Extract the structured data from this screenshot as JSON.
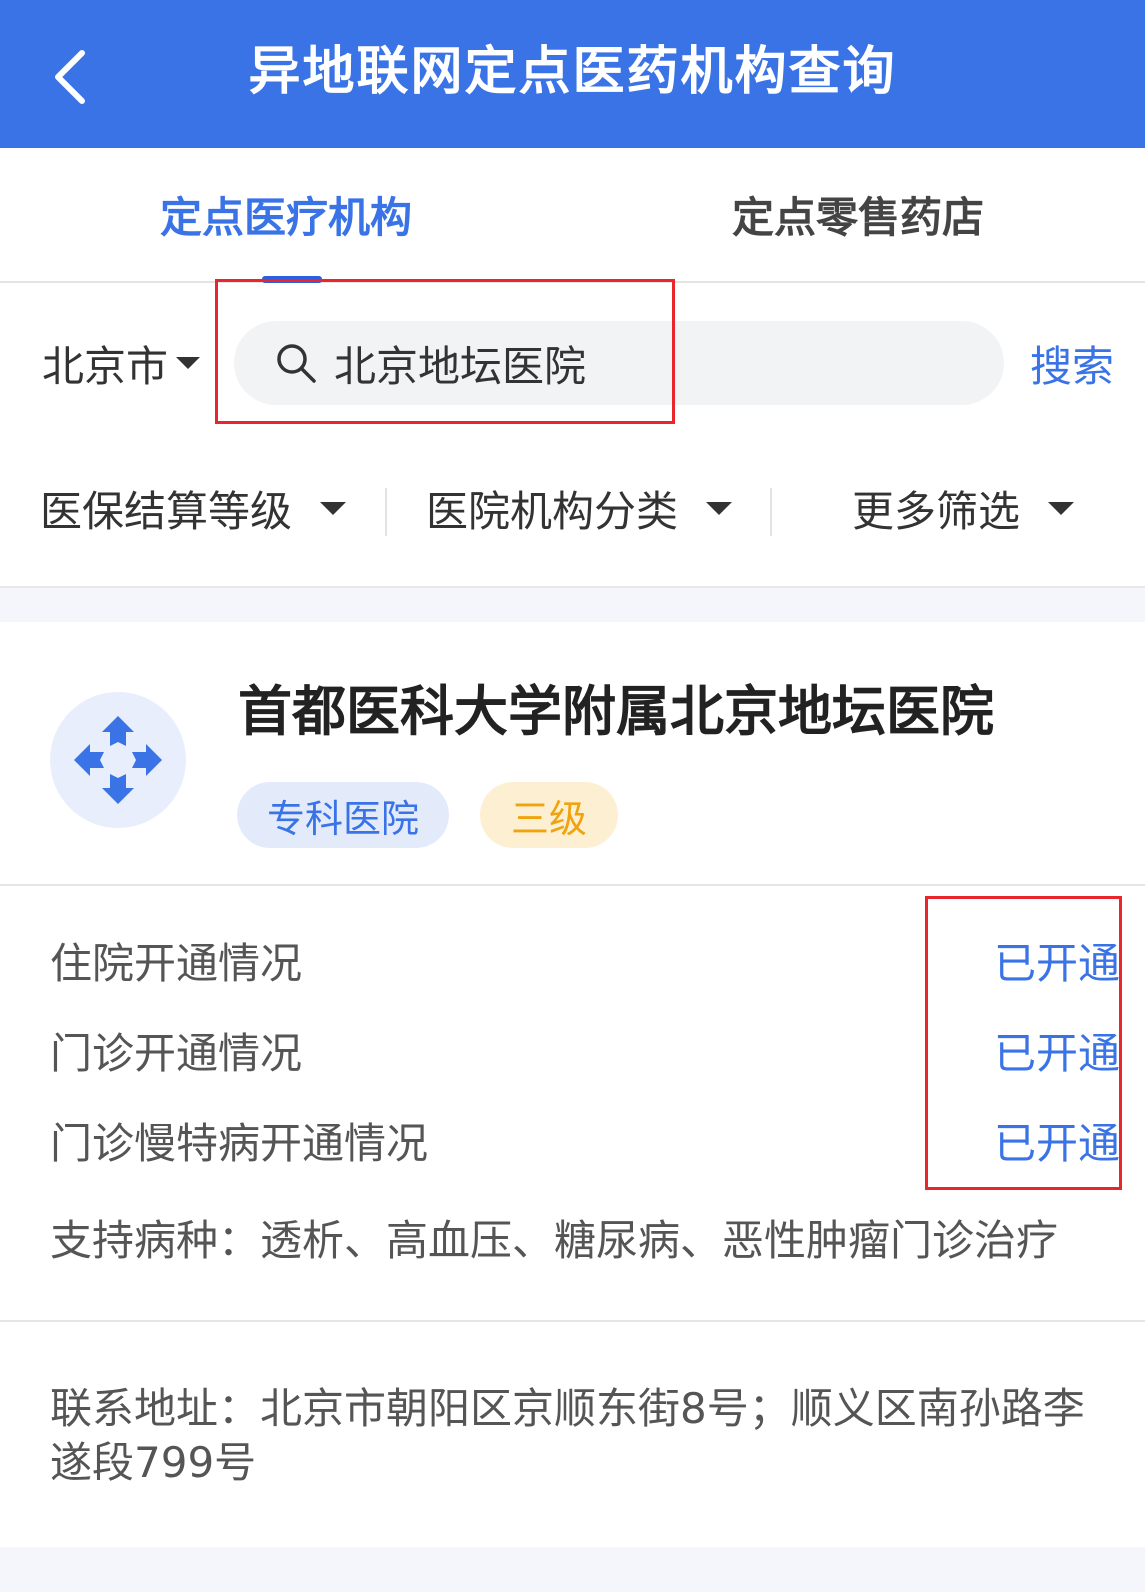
{
  "header": {
    "title": "异地联网定点医药机构查询",
    "back_icon": "chevron-left-icon"
  },
  "tabs": [
    {
      "label": "定点医疗机构",
      "active": true
    },
    {
      "label": "定点零售药店",
      "active": false
    }
  ],
  "search": {
    "city": "北京市",
    "query": "北京地坛医院",
    "button_label": "搜索",
    "icon": "search-icon"
  },
  "filters": [
    {
      "label": "医保结算等级"
    },
    {
      "label": "医院机构分类"
    },
    {
      "label": "更多筛选"
    }
  ],
  "result": {
    "name": "首都医科大学附属北京地坛医院",
    "logo_icon": "medical-cross-icon",
    "tags": {
      "type": "专科医院",
      "level": "三级"
    },
    "rows": [
      {
        "label": "住院开通情况",
        "status": "已开通"
      },
      {
        "label": "门诊开通情况",
        "status": "已开通"
      },
      {
        "label": "门诊慢特病开通情况",
        "status": "已开通"
      }
    ],
    "diseases": "支持病种：透析、高血压、糖尿病、恶性肿瘤门诊治疗",
    "address": "联系地址：北京市朝阳区京顺东街8号；顺义区南孙路李遂段799号"
  },
  "colors": {
    "primary": "#3a73e6",
    "highlight_box": "#e8262b",
    "level_badge": "#efa40f"
  }
}
